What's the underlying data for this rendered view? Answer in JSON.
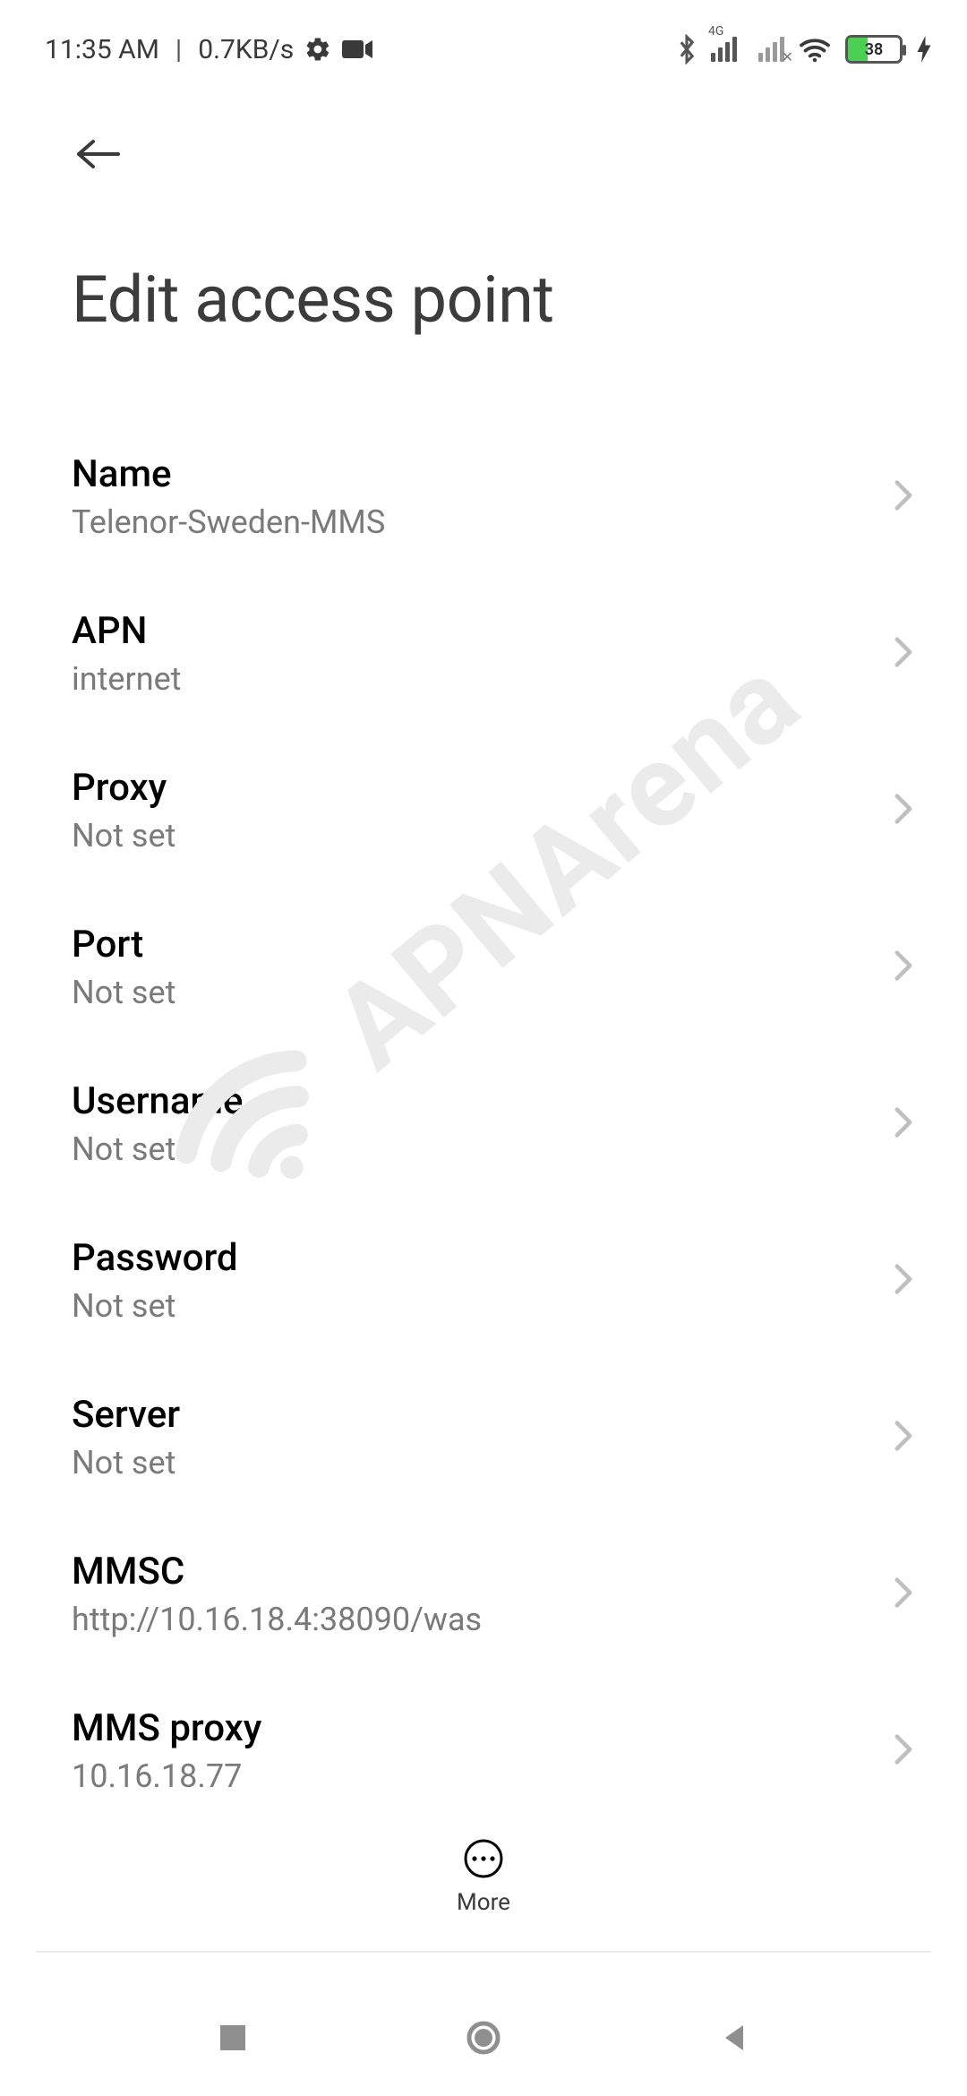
{
  "status": {
    "time": "11:35 AM",
    "speed": "0.7KB/s",
    "network_tag": "4G",
    "battery_pct": "38"
  },
  "header": {
    "title": "Edit access point"
  },
  "settings": [
    {
      "label": "Name",
      "value": "Telenor-Sweden-MMS"
    },
    {
      "label": "APN",
      "value": "internet"
    },
    {
      "label": "Proxy",
      "value": "Not set"
    },
    {
      "label": "Port",
      "value": "Not set"
    },
    {
      "label": "Username",
      "value": "Not set"
    },
    {
      "label": "Password",
      "value": "Not set"
    },
    {
      "label": "Server",
      "value": "Not set"
    },
    {
      "label": "MMSC",
      "value": "http://10.16.18.4:38090/was"
    },
    {
      "label": "MMS proxy",
      "value": "10.16.18.77"
    }
  ],
  "bottom": {
    "more_label": "More"
  },
  "watermark_text": "APNArena"
}
